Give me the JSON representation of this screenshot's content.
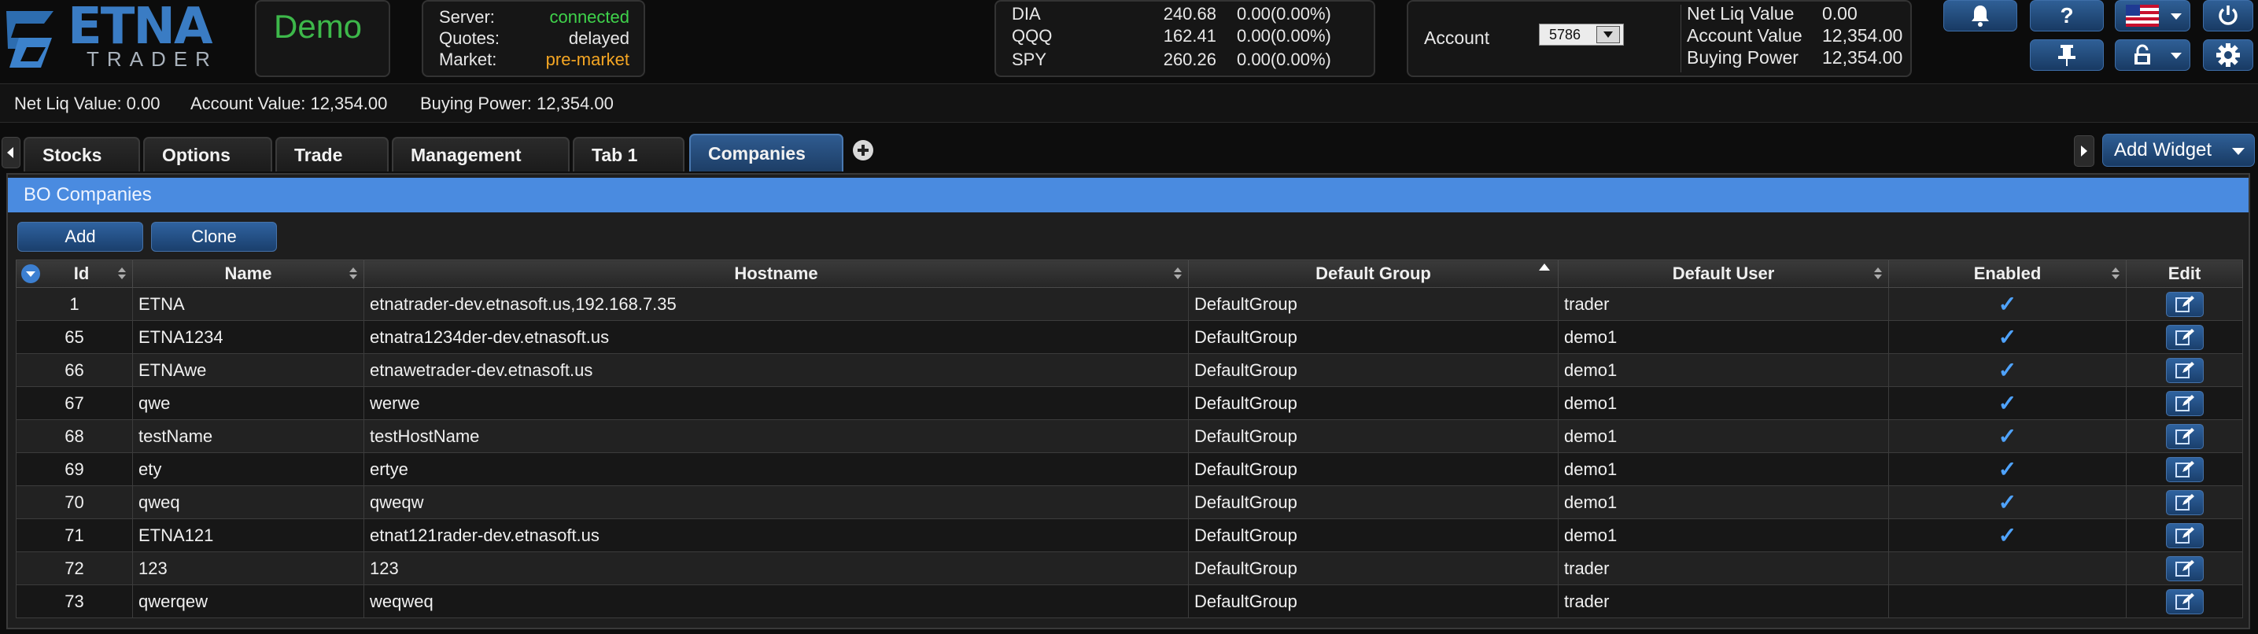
{
  "brand": {
    "name": "ETNA",
    "sub": "TRADER",
    "mode": "Demo"
  },
  "server_status": [
    {
      "label": "Server:",
      "value": "connected",
      "color": "#3fd34b"
    },
    {
      "label": "Quotes:",
      "value": "delayed",
      "color": "#e8e8e8"
    },
    {
      "label": "Market:",
      "value": "pre-market",
      "color": "#f5a623"
    }
  ],
  "quotes": [
    {
      "symbol": "DIA",
      "price": "240.68",
      "change": "0.00(0.00%)"
    },
    {
      "symbol": "QQQ",
      "price": "162.41",
      "change": "0.00(0.00%)"
    },
    {
      "symbol": "SPY",
      "price": "260.26",
      "change": "0.00(0.00%)"
    }
  ],
  "account": {
    "label": "Account",
    "selected": "5786",
    "metrics": [
      {
        "label": "Net Liq Value",
        "value": "0.00"
      },
      {
        "label": "Account Value",
        "value": "12,354.00"
      },
      {
        "label": "Buying Power",
        "value": "12,354.00"
      }
    ]
  },
  "toolbar_icons": [
    "bell-icon",
    "help-icon",
    "us-flag-icon",
    "pin-icon",
    "lock-icon",
    "power-icon",
    "gear-icon"
  ],
  "status_bar": [
    "Net Liq Value: 0.00",
    "Account Value: 12,354.00",
    "Buying Power: 12,354.00"
  ],
  "tabs": [
    {
      "label": "Stocks",
      "active": false
    },
    {
      "label": "Options",
      "active": false
    },
    {
      "label": "Trade",
      "active": false
    },
    {
      "label": "Management",
      "active": false
    },
    {
      "label": "Tab 1",
      "active": false
    },
    {
      "label": "Companies",
      "active": true
    }
  ],
  "add_widget_label": "Add Widget",
  "widget": {
    "title": "BO Companies",
    "buttons": {
      "add": "Add",
      "clone": "Clone"
    },
    "columns": [
      "Id",
      "Name",
      "Hostname",
      "Default Group",
      "Default User",
      "Enabled",
      "Edit"
    ],
    "sorted_column": "Default Group",
    "rows": [
      {
        "id": "1",
        "name": "ETNA",
        "hostname": "etnatrader-dev.etnasoft.us,192.168.7.35",
        "group": "DefaultGroup",
        "user": "trader",
        "enabled": true
      },
      {
        "id": "65",
        "name": "ETNA1234",
        "hostname": "etnatra1234der-dev.etnasoft.us",
        "group": "DefaultGroup",
        "user": "demo1",
        "enabled": true
      },
      {
        "id": "66",
        "name": "ETNAwe",
        "hostname": "etnawetrader-dev.etnasoft.us",
        "group": "DefaultGroup",
        "user": "demo1",
        "enabled": true
      },
      {
        "id": "67",
        "name": "qwe",
        "hostname": "werwe",
        "group": "DefaultGroup",
        "user": "demo1",
        "enabled": true
      },
      {
        "id": "68",
        "name": "testName",
        "hostname": "testHostName",
        "group": "DefaultGroup",
        "user": "demo1",
        "enabled": true
      },
      {
        "id": "69",
        "name": "ety",
        "hostname": "ertye",
        "group": "DefaultGroup",
        "user": "demo1",
        "enabled": true
      },
      {
        "id": "70",
        "name": "qweq",
        "hostname": "qweqw",
        "group": "DefaultGroup",
        "user": "demo1",
        "enabled": true
      },
      {
        "id": "71",
        "name": "ETNA121",
        "hostname": "etnat121rader-dev.etnasoft.us",
        "group": "DefaultGroup",
        "user": "demo1",
        "enabled": true
      },
      {
        "id": "72",
        "name": "123",
        "hostname": "123",
        "group": "DefaultGroup",
        "user": "trader",
        "enabled": false
      },
      {
        "id": "73",
        "name": "qwerqew",
        "hostname": "weqweq",
        "group": "DefaultGroup",
        "user": "trader",
        "enabled": false
      }
    ]
  }
}
